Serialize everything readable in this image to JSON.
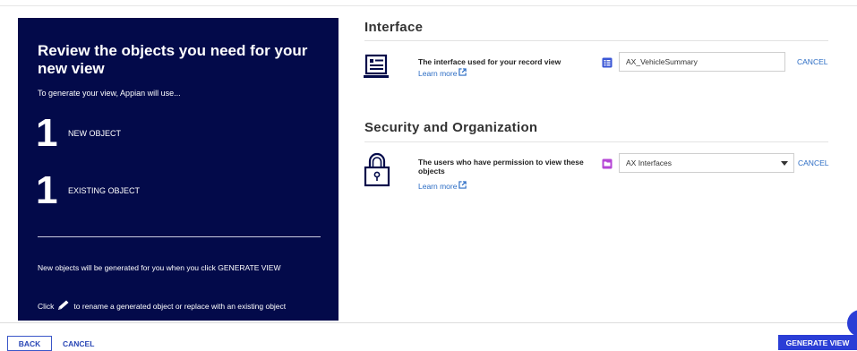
{
  "summary": {
    "title": "Review the objects you need for your new view",
    "subtitle": "To generate your view, Appian will use...",
    "new_count": "1",
    "new_label": "NEW OBJECT",
    "existing_count": "1",
    "existing_label": "EXISTING OBJECT",
    "note": "New objects will be generated for you when you click GENERATE VIEW",
    "rename_prefix": "Click",
    "rename_suffix": "to rename a generated object or replace with an existing object"
  },
  "interface_section": {
    "heading": "Interface",
    "label": "The interface used for your record view",
    "learn_more": "Learn more",
    "value": "AX_VehicleSummary",
    "cancel": "CANCEL"
  },
  "security_section": {
    "heading": "Security and Organization",
    "label": "The users who have permission to view these objects",
    "learn_more": "Learn more",
    "selected": "AX Interfaces",
    "cancel": "CANCEL"
  },
  "footer": {
    "back": "BACK",
    "cancel": "CANCEL",
    "generate": "GENERATE VIEW"
  },
  "colors": {
    "panel_bg": "#030a4a",
    "accent": "#2b3ed6",
    "link": "#2b6cc4"
  }
}
